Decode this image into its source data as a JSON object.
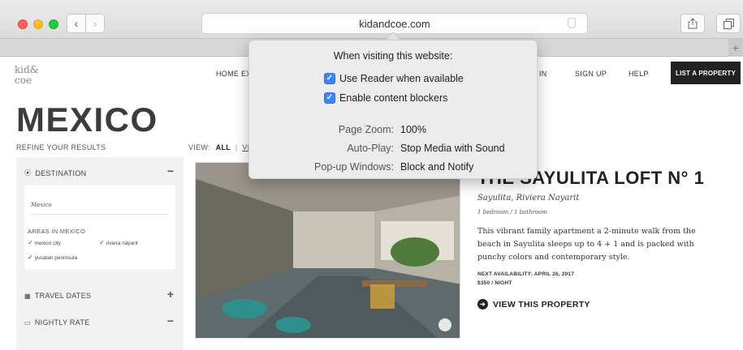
{
  "browser": {
    "url": "kidandcoe.com",
    "icons": [
      "back-icon",
      "forward-icon",
      "sidebar-icon",
      "share-icon",
      "tabs-icon"
    ]
  },
  "site": {
    "logo": {
      "line1": "kid&",
      "line2": "coe"
    },
    "nav": {
      "home_exchange": "HOME EX",
      "sign_in": "IN",
      "sign_up": "SIGN UP",
      "help": "HELP",
      "list_property": "LIST A PROPERTY"
    },
    "page_title": "MEXICO",
    "refine": "REFINE YOUR RESULTS",
    "view": {
      "label": "VIEW:",
      "all": "ALL",
      "sep": "|",
      "next": "VI"
    },
    "sidebar": {
      "destination": {
        "label": "DESTINATION",
        "toggle": "−",
        "value": "Mexico"
      },
      "areas_label": "AREAS IN MEXICO",
      "areas": [
        {
          "label": "mexico city"
        },
        {
          "label": "riviera nayarit"
        },
        {
          "label": "yucatan peninsula"
        }
      ],
      "travel_dates": {
        "label": "TRAVEL DATES",
        "toggle": "+"
      },
      "nightly_rate": {
        "label": "NIGHTLY RATE",
        "toggle": "−"
      }
    },
    "listing": {
      "title": "THE SAYULITA LOFT N° 1",
      "location": "Sayulita, Riviera Nayarit",
      "rooms": "1 bedroom / 1 bathroom",
      "description": "This vibrant family apartment a 2-minute walk from the beach in Sayulita sleeps up to 4 + 1 and is packed with punchy colors and contemporary style.",
      "next_availability": "NEXT AVAILABILITY: APRIL 26, 2017",
      "price": "$350 / NIGHT",
      "view_link": "VIEW THIS PROPERTY"
    }
  },
  "popover": {
    "title": "When visiting this website:",
    "reader": {
      "label": "Use Reader when available",
      "checked": true
    },
    "blockers": {
      "label": "Enable content blockers",
      "checked": true
    },
    "page_zoom": {
      "label": "Page Zoom:",
      "value": "100%"
    },
    "auto_play": {
      "label": "Auto-Play:",
      "value": "Stop Media with Sound"
    },
    "popups": {
      "label": "Pop-up Windows:",
      "value": "Block and Notify"
    }
  }
}
